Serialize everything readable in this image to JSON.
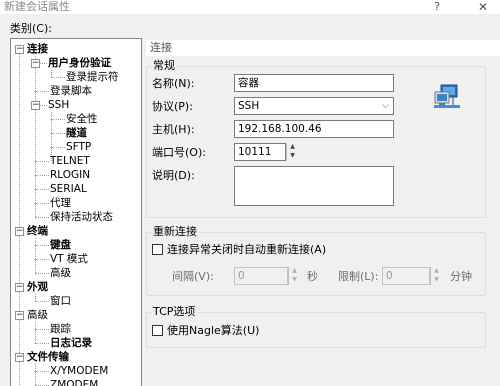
{
  "window": {
    "title": "新建会话属性",
    "help_glyph": "?",
    "close_glyph": "✕"
  },
  "category_label": "类别(C):",
  "tree": [
    {
      "label": "连接",
      "bold": true
    },
    {
      "label": "用户身份验证",
      "bold": true
    },
    {
      "label": "登录提示符",
      "bold": false
    },
    {
      "label": "登录脚本",
      "bold": false
    },
    {
      "label": "SSH",
      "bold": false
    },
    {
      "label": "安全性",
      "bold": false
    },
    {
      "label": "隧道",
      "bold": true
    },
    {
      "label": "SFTP",
      "bold": false
    },
    {
      "label": "TELNET",
      "bold": false
    },
    {
      "label": "RLOGIN",
      "bold": false
    },
    {
      "label": "SERIAL",
      "bold": false
    },
    {
      "label": "代理",
      "bold": false
    },
    {
      "label": "保持活动状态",
      "bold": false
    },
    {
      "label": "终端",
      "bold": true
    },
    {
      "label": "键盘",
      "bold": true
    },
    {
      "label": "VT 模式",
      "bold": false
    },
    {
      "label": "高级",
      "bold": false
    },
    {
      "label": "外观",
      "bold": true
    },
    {
      "label": "窗口",
      "bold": false
    },
    {
      "label": "高级",
      "bold": false
    },
    {
      "label": "跟踪",
      "bold": false
    },
    {
      "label": "日志记录",
      "bold": true
    },
    {
      "label": "文件传输",
      "bold": true
    },
    {
      "label": "X/YMODEM",
      "bold": false
    },
    {
      "label": "ZMODEM",
      "bold": false
    }
  ],
  "panel": {
    "title": "连接",
    "general": {
      "title": "常规",
      "name_label": "名称(N):",
      "name_value": "容器",
      "protocol_label": "协议(P):",
      "protocol_value": "SSH",
      "host_label": "主机(H):",
      "host_value": "192.168.100.46",
      "port_label": "端口号(O):",
      "port_value": "10111",
      "desc_label": "说明(D):",
      "desc_value": ""
    },
    "reconnect": {
      "title": "重新连接",
      "auto_reconnect_label": "连接异常关闭时自动重新连接(A)",
      "interval_label": "间隔(V):",
      "interval_value": "0",
      "interval_unit": "秒",
      "limit_label": "限制(L):",
      "limit_value": "0",
      "limit_unit": "分钟"
    },
    "tcp": {
      "title": "TCP选项",
      "nagle_label": "使用Nagle算法(U)"
    }
  },
  "spin_up": "▲",
  "spin_down": "▼",
  "dropdown_arrow": "⌵",
  "icons": {
    "network": "network-computers-icon"
  }
}
